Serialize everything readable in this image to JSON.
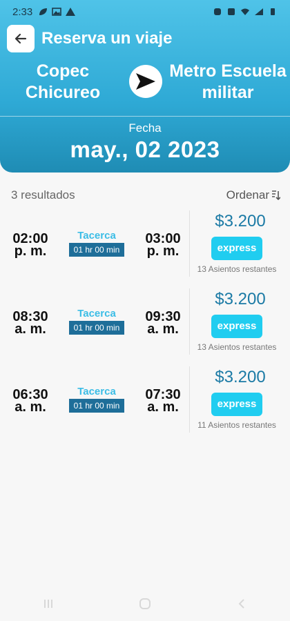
{
  "status": {
    "time": "2:33"
  },
  "header": {
    "title": "Reserva un viaje",
    "origin": [
      "Copec",
      "Chicureo"
    ],
    "destination": [
      "Metro Escuela",
      "militar"
    ],
    "date_label": "Fecha",
    "date_value": "may., 02 2023"
  },
  "results": {
    "count_label": "3 resultados",
    "sort_label": "Ordenar"
  },
  "trips": [
    {
      "dep_time": "02:00",
      "dep_ampm": "p. m.",
      "company": "Tacerca",
      "duration": "01 hr 00 min",
      "arr_time": "03:00",
      "arr_ampm": "p. m.",
      "price": "$3.200",
      "badge": "express",
      "seats": "13 Asientos restantes"
    },
    {
      "dep_time": "08:30",
      "dep_ampm": "a. m.",
      "company": "Tacerca",
      "duration": "01 hr 00 min",
      "arr_time": "09:30",
      "arr_ampm": "a. m.",
      "price": "$3.200",
      "badge": "express",
      "seats": "13 Asientos restantes"
    },
    {
      "dep_time": "06:30",
      "dep_ampm": "a. m.",
      "company": "Tacerca",
      "duration": "01 hr 00 min",
      "arr_time": "07:30",
      "arr_ampm": "a. m.",
      "price": "$3.200",
      "badge": "express",
      "seats": "11 Asientos restantes"
    }
  ],
  "colors": {
    "header_top": "#4fc3e8",
    "header_bottom": "#1f8cb4",
    "price": "#1b7aa5",
    "badge": "#20cdf0",
    "company": "#3bbde6",
    "duration_bg": "#1e6e99"
  },
  "icons": {
    "back": "arrow-left-icon",
    "route": "send-arrow-icon",
    "sort": "sort-icon"
  }
}
